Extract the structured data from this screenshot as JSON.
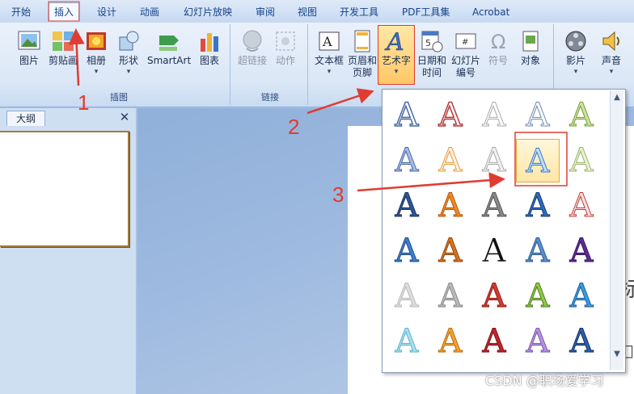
{
  "tabs": [
    {
      "label": "开始"
    },
    {
      "label": "插入"
    },
    {
      "label": "设计"
    },
    {
      "label": "动画"
    },
    {
      "label": "幻灯片放映"
    },
    {
      "label": "审阅"
    },
    {
      "label": "视图"
    },
    {
      "label": "开发工具"
    },
    {
      "label": "PDF工具集"
    },
    {
      "label": "Acrobat"
    }
  ],
  "ribbon": {
    "illustrations": {
      "group_label": "插图",
      "picture": "图片",
      "clipart": "剪贴画",
      "album": "相册",
      "shapes": "形状",
      "smartart": "SmartArt",
      "chart": "图表"
    },
    "links": {
      "group_label": "链接",
      "hyperlink": "超链接",
      "action": "动作"
    },
    "text": {
      "textbox": "文本框",
      "header_line1": "页眉和",
      "header_line2": "页脚",
      "wordart": "艺术字",
      "datetime_line1": "日期和",
      "datetime_line2": "时间",
      "slidenum_line1": "幻灯片",
      "slidenum_line2": "编号",
      "symbol": "符号",
      "object": "对象"
    },
    "media": {
      "movie": "影片",
      "sound": "声音"
    }
  },
  "left_panel": {
    "tab_label": "大纲",
    "close_glyph": "✕"
  },
  "gallery": {
    "letter": "A",
    "scroll_up": "▲",
    "scroll_down": "▼"
  },
  "annotations": {
    "n1": "1",
    "n2": "2",
    "n3": "3"
  },
  "edge_text": {
    "line1": "标",
    "line2": "□"
  },
  "watermark": "CSDN @职场爱学习",
  "colors": {
    "annotation": "#e03c31",
    "ribbon_text": "#15428b"
  }
}
